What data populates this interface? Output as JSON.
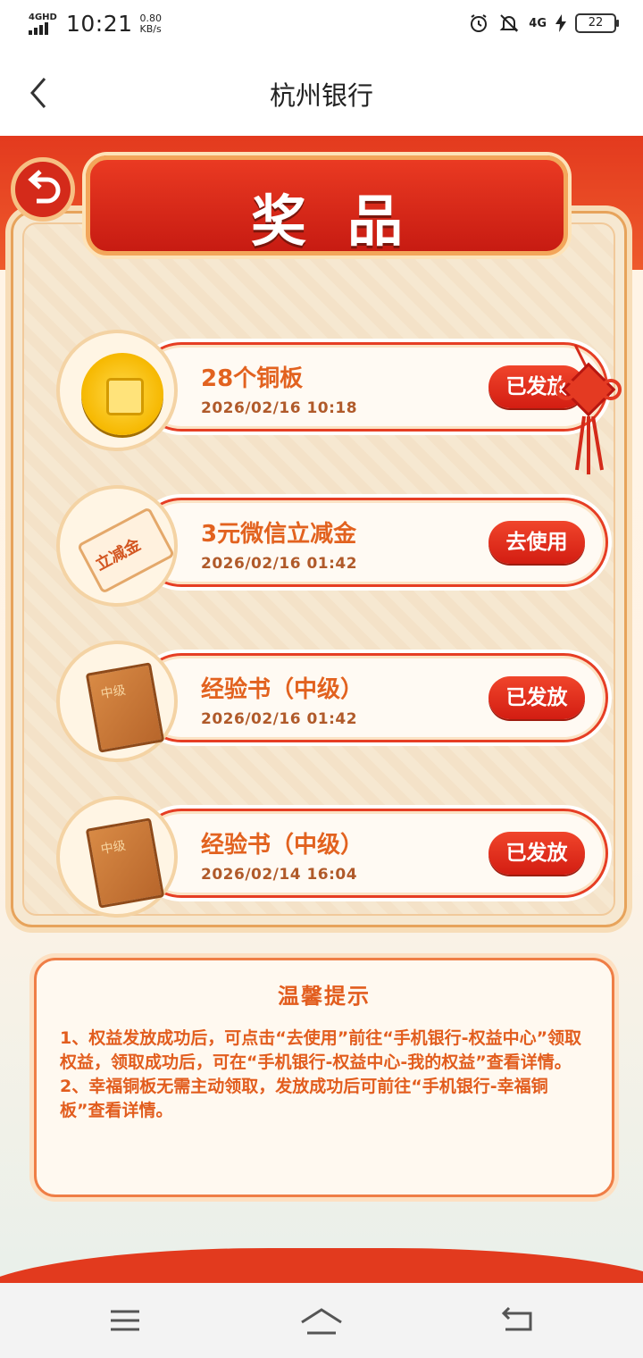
{
  "status_bar": {
    "network_label": "4GHD",
    "time": "10:21",
    "speed_value": "0.80",
    "speed_unit": "KB/s",
    "network_label_right": "4G",
    "battery": "22"
  },
  "header": {
    "title": "杭州银行"
  },
  "banner": {
    "title": "奖品"
  },
  "prizes": [
    {
      "name": "28个铜板",
      "time": "2026/02/16 10:18",
      "status": "已发放",
      "icon": "coin-icon"
    },
    {
      "name": "3元微信立减金",
      "time": "2026/02/16 01:42",
      "status": "去使用",
      "icon": "coupon-icon",
      "icon_text": "立减金"
    },
    {
      "name": "经验书（中级）",
      "time": "2026/02/16 01:42",
      "status": "已发放",
      "icon": "book-icon",
      "icon_text": "中级"
    },
    {
      "name": "经验书（中级）",
      "time": "2026/02/14 16:04",
      "status": "已发放",
      "icon": "book-icon",
      "icon_text": "中级"
    }
  ],
  "tips": {
    "title": "温馨提示",
    "line1": "1、权益发放成功后，可点击“去使用”前往“手机银行-权益中心”领取权益，领取成功后，可在“手机银行-权益中心-我的权益”查看详情。",
    "line2": "2、幸福铜板无需主动领取，发放成功后可前往“手机银行-幸福铜板”查看详情。"
  },
  "colors": {
    "accent_red": "#e23a1e",
    "text_orange": "#e2621f"
  }
}
